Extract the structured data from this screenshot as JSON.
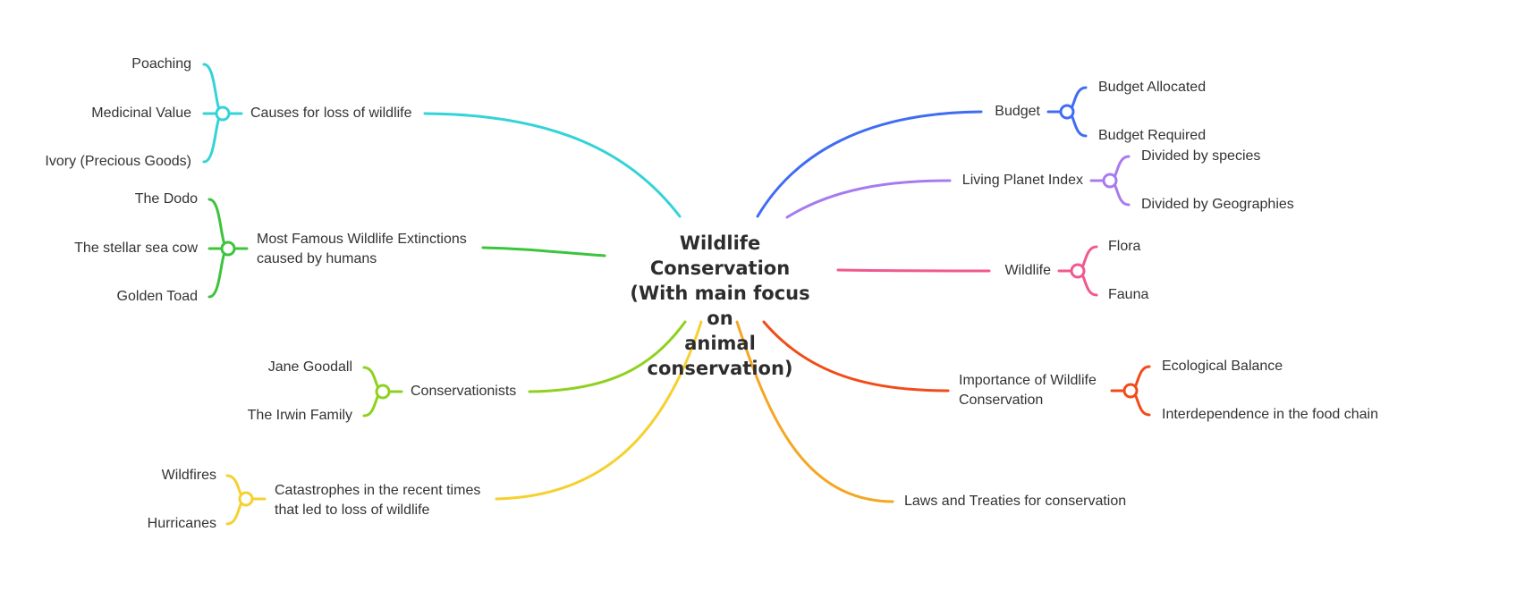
{
  "center": {
    "lines": [
      "Wildlife Conservation",
      "(With main focus on",
      "animal conservation)"
    ]
  },
  "branches": {
    "causes": {
      "label": "Causes for loss of wildlife",
      "color": "#34d3d8",
      "children": [
        "Poaching",
        "Medicinal Value",
        "Ivory (Precious Goods)"
      ]
    },
    "extinctions": {
      "label_lines": [
        "Most Famous Wildlife Extinctions",
        "caused by humans"
      ],
      "color": "#3cc43c",
      "children": [
        "The Dodo",
        "The stellar sea cow",
        "Golden Toad"
      ]
    },
    "conservationists": {
      "label": "Conservationists",
      "color": "#8fd11f",
      "children": [
        "Jane Goodall",
        "The Irwin Family"
      ]
    },
    "catastrophes": {
      "label_lines": [
        "Catastrophes in the recent times",
        "that led to loss of wildlife"
      ],
      "color": "#f5d130",
      "children": [
        "Wildfires",
        "Hurricanes"
      ]
    },
    "budget": {
      "label": "Budget",
      "color": "#3f6cf4",
      "children": [
        "Budget Allocated",
        "Budget Required"
      ]
    },
    "lpi": {
      "label": "Living Planet Index",
      "color": "#a77bf0",
      "children": [
        "Divided by species",
        "Divided by Geographies"
      ]
    },
    "wildlife": {
      "label": "Wildlife",
      "color": "#f0588f",
      "children": [
        "Flora",
        "Fauna"
      ]
    },
    "importance": {
      "label_lines": [
        "Importance of Wildlife",
        "Conservation"
      ],
      "color": "#f24b1a",
      "children": [
        "Ecological Balance",
        "Interdependence in the food chain"
      ]
    },
    "laws": {
      "label": "Laws and Treaties for conservation",
      "color": "#f5a623",
      "children": []
    }
  }
}
